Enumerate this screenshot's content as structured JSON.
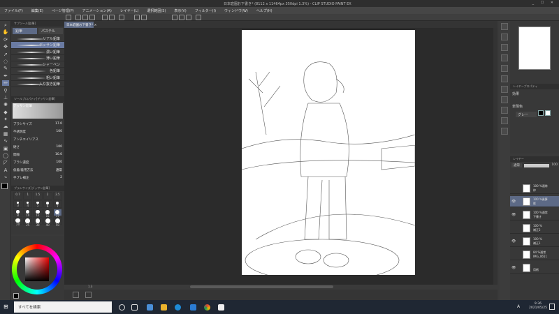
{
  "window": {
    "title": "日本庭園お下書き* (8112 x 11464px 350dpi 1.3%) - CLIP STUDIO PAINT EX",
    "controls": "_ ☐ ✕"
  },
  "menu": [
    "ファイル(F)",
    "編集(E)",
    "ページ管理(P)",
    "アニメーション(A)",
    "レイヤー(L)",
    "選択範囲(S)",
    "表示(V)",
    "フィルター(I)",
    "ウィンドウ(W)",
    "ヘルプ(H)"
  ],
  "document_tab": "日本庭園お下書き* ×",
  "subtool": {
    "title": "サブツール[鉛筆]",
    "tabs": [
      "鉛筆",
      "パステル"
    ],
    "brushes": [
      "リアル鉛筆",
      "デッサン鉛筆",
      "濃い鉛筆",
      "薄い鉛筆",
      "シャーペン",
      "色鉛筆",
      "粗い鉛筆",
      "入り抜き鉛筆"
    ],
    "selected": 1
  },
  "tool_property": {
    "title": "ツールプロパティ[デッサン鉛筆]",
    "preset": "デッサン鉛筆",
    "rows": [
      {
        "label": "ブラシサイズ",
        "value": "17.0"
      },
      {
        "label": "不透明度",
        "value": "100"
      },
      {
        "label": "アンチエイリアス",
        "value": ""
      },
      {
        "label": "硬さ",
        "value": "100"
      },
      {
        "label": "間隔",
        "value": "10.0"
      },
      {
        "label": "ブラシ濃度",
        "value": "100"
      },
      {
        "label": "仮着/着用方法",
        "value": "通常"
      },
      {
        "label": "手ブレ補正",
        "value": "2"
      }
    ]
  },
  "brush_size": {
    "title": "ブラシサイズ[デッサン鉛筆]",
    "sizes": [
      "0.7",
      "1",
      "1.5",
      "2",
      "2.5",
      "3",
      "4",
      "5",
      "6",
      "7",
      "8",
      "10",
      "12",
      "15",
      "17",
      "20",
      "25",
      "30",
      "40",
      "50"
    ],
    "selected": "17"
  },
  "status": {
    "zoom": "1.3"
  },
  "layer_property": {
    "title": "レイヤープロパティ",
    "effect_label": "効果",
    "color_label": "表現色",
    "color_value": "グレー"
  },
  "layers": {
    "title": "レイヤー",
    "blend": "通常",
    "opacity": "100",
    "items": [
      {
        "name": "枠",
        "mode": "100 %通常",
        "visible": false,
        "selected": false
      },
      {
        "name": "影",
        "mode": "100 %乗算",
        "visible": true,
        "selected": true
      },
      {
        "name": "下書き",
        "mode": "100 %通常",
        "visible": true,
        "selected": false
      },
      {
        "name": "補正2",
        "mode": "100 %",
        "visible": false,
        "selected": false
      },
      {
        "name": "補正1",
        "mode": "100 %",
        "visible": true,
        "selected": false
      },
      {
        "name": "IMG_0651",
        "mode": "84 %通常",
        "visible": false,
        "selected": false
      },
      {
        "name": "用紙",
        "mode": "",
        "visible": true,
        "selected": false
      }
    ]
  },
  "taskbar": {
    "search_placeholder": "すべてを検索",
    "time": "9:36",
    "date": "2021/05/25",
    "ime": "A"
  },
  "colors": {
    "accent": "#6a7ba3",
    "main_color": "#000000",
    "sub_color": "#ffffff"
  }
}
